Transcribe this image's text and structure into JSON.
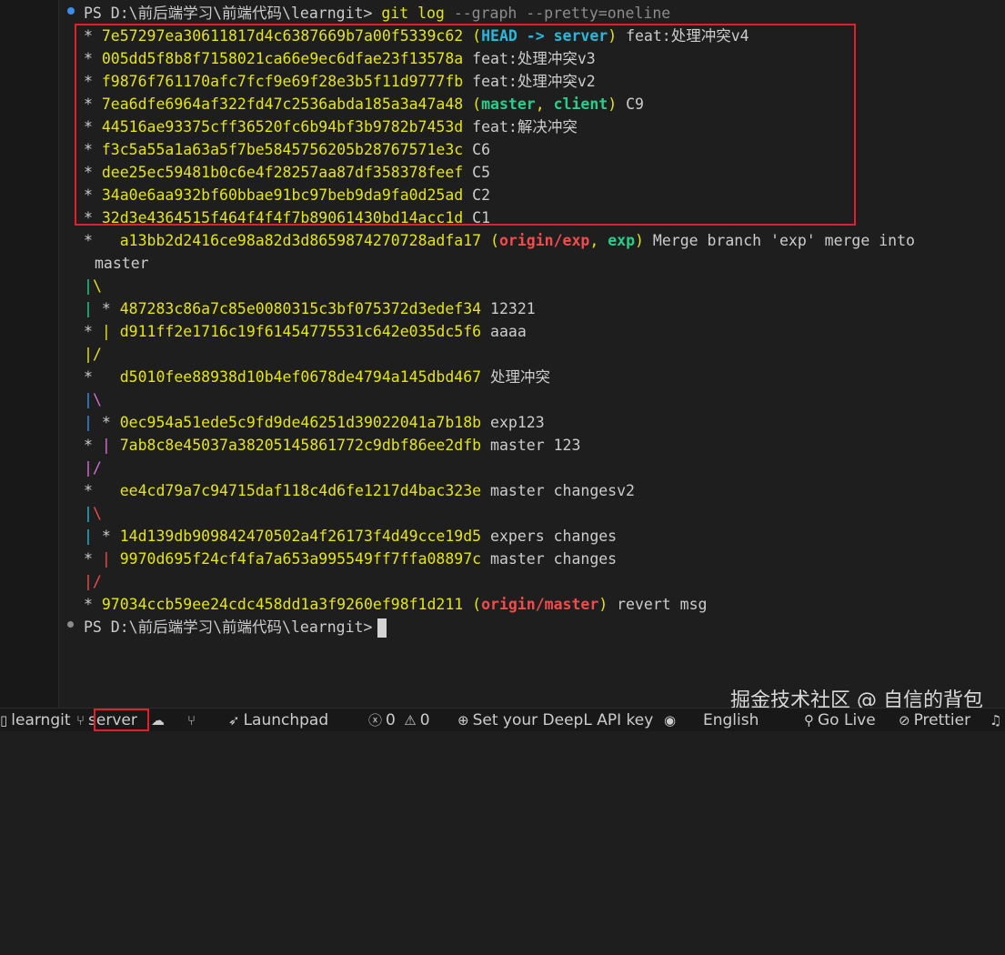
{
  "terminal": {
    "prompt_path": "PS D:\\前后端学习\\前端代码\\learngit>",
    "command_git": "git log",
    "command_flags": "--graph --pretty=oneline",
    "commits": [
      {
        "graph": "* ",
        "hash": "7e57297ea30611817d4c6387669b7a00f5339c62",
        "refs_open": "(",
        "ref_head": "HEAD -> server",
        "refs_close": ")",
        "msg": "feat:处理冲突v4"
      },
      {
        "graph": "* ",
        "hash": "005dd5f8b8f7158021ca66e9ec6dfae23f13578a",
        "msg": "feat:处理冲突v3"
      },
      {
        "graph": "* ",
        "hash": "f9876f761170afc7fcf9e69f28e3b5f11d9777fb",
        "msg": "feat:处理冲突v2"
      },
      {
        "graph": "* ",
        "hash": "7ea6dfe6964af322fd47c2536abda185a3a47a48",
        "ref_master": "master",
        "ref_client": "client",
        "msg": "C9"
      },
      {
        "graph": "* ",
        "hash": "44516ae93375cff36520fc6b94bf3b9782b7453d",
        "msg": "feat:解决冲突"
      },
      {
        "graph": "* ",
        "hash": "f3c5a55a1a63a5f7be5845756205b28767571e3c",
        "msg": "C6"
      },
      {
        "graph": "* ",
        "hash": "dee25ec59481b0c6e4f28257aa87df358378feef",
        "msg": "C5"
      },
      {
        "graph": "* ",
        "hash": "34a0e6aa932bf60bbae91bc97beb9da9fa0d25ad",
        "msg": "C2"
      },
      {
        "graph": "* ",
        "hash": "32d3e4364515f464f4f4f7b89061430bd14acc1d",
        "msg": "C1"
      }
    ],
    "merge1": {
      "hash": "a13bb2d2416ce98a82d3d8659874270728adfa17",
      "ref_origin": "origin/exp",
      "ref_exp": "exp",
      "msg": "Merge branch 'exp' merge into",
      "msg_cont": "master"
    },
    "c_487": {
      "hash": "487283c86a7c85e0080315c3bf075372d3edef34",
      "msg": "12321"
    },
    "c_d91": {
      "hash": "d911ff2e1716c19f61454775531c642e035dc5f6",
      "msg": "aaaa"
    },
    "c_d50": {
      "hash": "d5010fee88938d10b4ef0678de4794a145dbd467",
      "msg": "处理冲突"
    },
    "c_0ec": {
      "hash": "0ec954a51ede5c9fd9de46251d39022041a7b18b",
      "msg": "exp123"
    },
    "c_7ab": {
      "hash": "7ab8c8e45037a38205145861772c9dbf86ee2dfb",
      "msg": "master 123"
    },
    "c_ee4": {
      "hash": "ee4cd79a7c94715daf118c4d6fe1217d4bac323e",
      "msg": "master changesv2"
    },
    "c_14d": {
      "hash": "14d139db909842470502a4f26173f4d49cce19d5",
      "msg": "expers changes"
    },
    "c_997": {
      "hash": "9970d695f24cf4fa7a653a995549ff7ffa08897c",
      "msg": "master changes"
    },
    "c_970": {
      "hash": "97034ccb59ee24cdc458dd1a3f9260ef98f1d211",
      "ref_origin_master": "origin/master",
      "msg": "revert msg"
    }
  },
  "watermark": "掘金技术社区 @ 自信的背包",
  "statusbar": {
    "folder": "learngit",
    "branch": "server",
    "launchpad": "Launchpad",
    "errors": "0",
    "warnings": "0",
    "deepl": "Set your DeepL API key",
    "language": "English",
    "golive": "Go Live",
    "prettier": "Prettier"
  },
  "colors": {
    "hash": "#e5e510",
    "head": "#29b8db",
    "branch": "#23d18b",
    "remote": "#f14c4c",
    "highlight": "#e0202a"
  }
}
